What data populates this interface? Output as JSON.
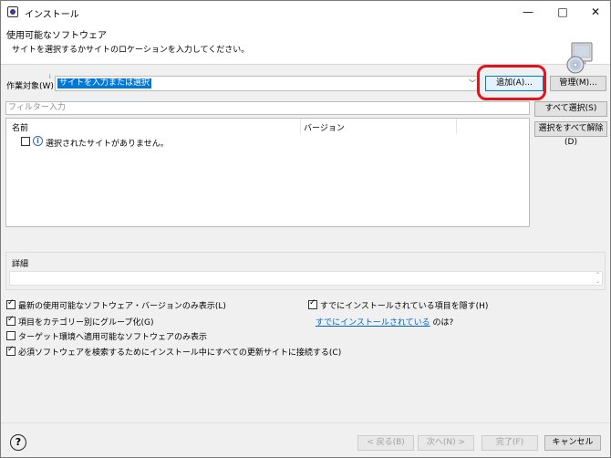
{
  "window": {
    "title": "インストール",
    "icon": "app-icon",
    "controls": {
      "minimize": "—",
      "maximize": "□",
      "close": "✕"
    }
  },
  "banner": {
    "title": "使用可能なソフトウェア",
    "description": "サイトを選択するかサイトのロケーションを入力してください。",
    "icon": "cd-install-icon"
  },
  "work_with": {
    "label": "作業対象(W):",
    "value": "サイトを入力または選択",
    "add_label": "追加(A)...",
    "manage_label": "管理(M)..."
  },
  "filter": {
    "placeholder": "フィルター入力"
  },
  "table": {
    "columns": [
      "名前",
      "バージョン"
    ],
    "rows": [
      {
        "text": "選択されたサイトがありません。",
        "icon": "info-icon",
        "checked": false
      }
    ]
  },
  "side_buttons": {
    "select_all": "すべて選択(S)",
    "deselect_all": "選択をすべて解除(D)"
  },
  "details": {
    "label": "詳細"
  },
  "options": {
    "latest_only": {
      "label": "最新の使用可能なソフトウェア・バージョンのみ表示(L)",
      "checked": true
    },
    "group_by_category": {
      "label": "項目をカテゴリー別にグループ化(G)",
      "checked": true
    },
    "target_env": {
      "label": "ターゲット環境へ適用可能なソフトウェアのみ表示",
      "checked": false
    },
    "contact_all": {
      "label": "必須ソフトウェアを検索するためにインストール中にすべての更新サイトに接続する(C)",
      "checked": true
    },
    "hide_installed": {
      "label": "すでにインストールされている項目を隠す(H)",
      "checked": true
    },
    "installed_link": "すでにインストールされている",
    "installed_suffix": "のは?"
  },
  "footer": {
    "help": "?",
    "back": "< 戻る(B)",
    "next": "次へ(N) >",
    "finish": "完了(F)",
    "cancel": "キャンセル"
  },
  "colors": {
    "accent": "#0078d7",
    "highlight": "#e0141e",
    "link": "#0066cc"
  }
}
